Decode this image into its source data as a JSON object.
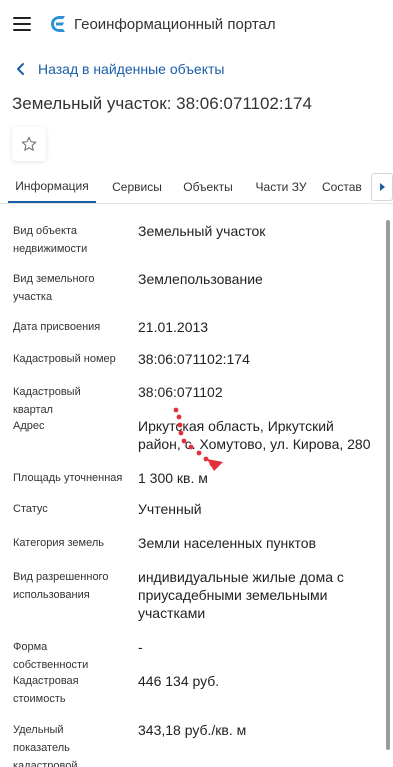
{
  "header": {
    "app_title": "Геоинформационный портал"
  },
  "nav": {
    "back_label": "Назад в найденные объекты"
  },
  "page": {
    "title": "Земельный участок: 38:06:071102:174"
  },
  "tabs": [
    {
      "label": "Информация",
      "active": true
    },
    {
      "label": "Сервисы",
      "active": false
    },
    {
      "label": "Объекты",
      "active": false
    },
    {
      "label": "Части ЗУ",
      "active": false
    },
    {
      "label": "Состав",
      "active": false
    }
  ],
  "properties": [
    {
      "label": "Вид объекта недвижимости",
      "value": "Земельный участок"
    },
    {
      "label": "Вид земельного участка",
      "value": "Землепользование"
    },
    {
      "label": "Дата присвоения",
      "value": "21.01.2013"
    },
    {
      "label": "Кадастровый номер",
      "value": "38:06:071102:174"
    },
    {
      "label": "Кадастровый квартал",
      "value": "38:06:071102"
    },
    {
      "label": "Адрес",
      "value": "Иркутская область, Иркутский район, с. Хомутово, ул. Кирова, 280"
    },
    {
      "label": "Площадь уточненная",
      "value": "1 300 кв. м"
    },
    {
      "label": "Статус",
      "value": "Учтенный"
    },
    {
      "label": "Категория земель",
      "value": "Земли населенных пунктов"
    },
    {
      "label": "Вид разрешенного использования",
      "value": "индивидуальные жилые дома с приусадебными земельными участками"
    },
    {
      "label": "Форма собственности",
      "value": "-"
    },
    {
      "label": "Кадастровая стоимость",
      "value": "446 134 руб."
    },
    {
      "label": "Удельный показатель кадастровой стоимости",
      "value": "343,18 руб./кв. м"
    }
  ],
  "colors": {
    "accent": "#1a5ea8",
    "logo": "#2b8fd6",
    "text": "#333333",
    "pointer_trail": "#e0303a"
  },
  "icons": {
    "menu": "hamburger-icon",
    "logo": "logo-icon",
    "back": "chevron-left-icon",
    "favorite": "star-outline-icon",
    "tab_scroll": "chevron-right-icon"
  }
}
